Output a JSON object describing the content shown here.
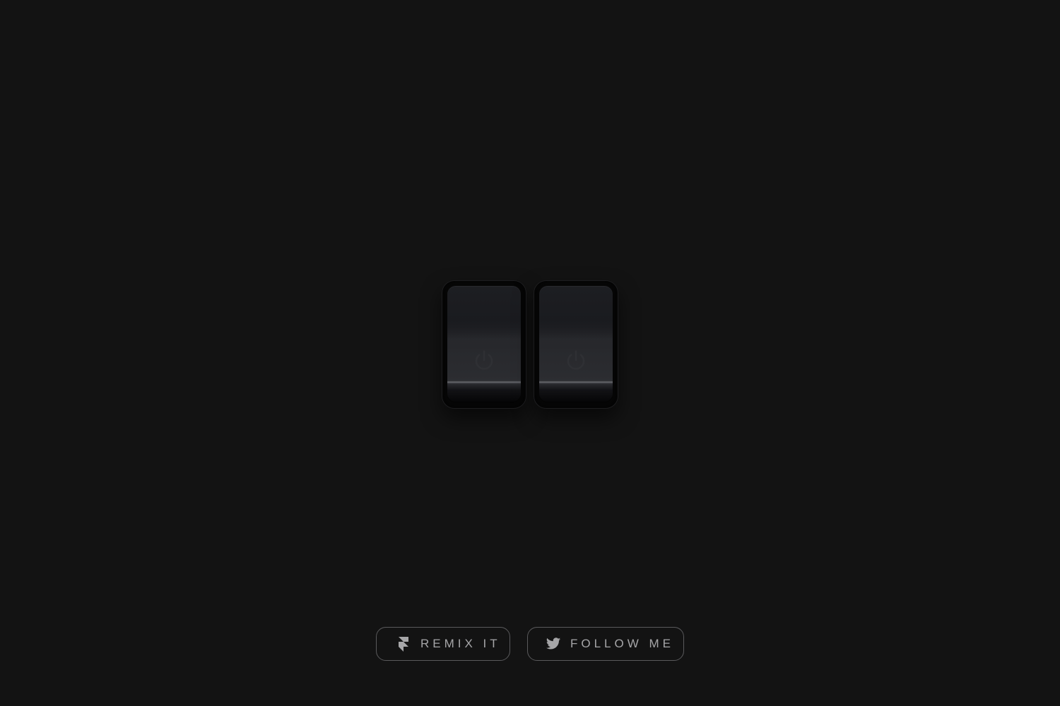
{
  "switches": [
    {
      "name": "switch-left",
      "state": "off",
      "icon": "power-icon"
    },
    {
      "name": "switch-right",
      "state": "off",
      "icon": "power-icon"
    }
  ],
  "buttons": {
    "remix": {
      "label": "REMIX IT",
      "icon": "framer-icon"
    },
    "follow": {
      "label": "FOLLOW ME",
      "icon": "twitter-bird-icon"
    }
  },
  "colors": {
    "background": "#131313",
    "button_border": "#5a5a5c",
    "button_text": "#a6a6a8",
    "power_icon": "#2f3034"
  }
}
